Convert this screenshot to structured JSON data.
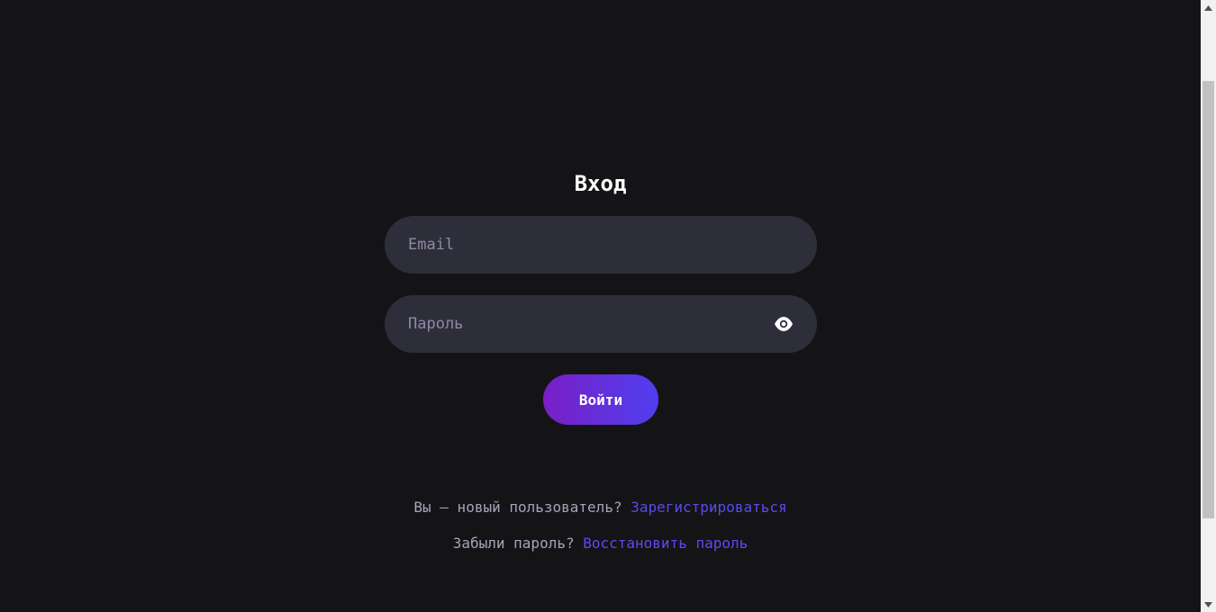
{
  "form": {
    "title": "Вход",
    "email_placeholder": "Email",
    "password_placeholder": "Пароль",
    "show_password_icon": "eye-icon",
    "submit_label": "Войти"
  },
  "footer": {
    "register_prompt": "Вы — новый пользователь?",
    "register_link": "Зарегистрироваться",
    "recover_prompt": "Забыли пароль?",
    "recover_link": "Восстановить пароль"
  },
  "colors": {
    "background": "#141416",
    "field_background": "#2e2e3a",
    "placeholder": "#8e89a8",
    "link": "#5b4af2",
    "button_gradient_start": "#7a1fc4",
    "button_gradient_end": "#4f3ff0"
  }
}
